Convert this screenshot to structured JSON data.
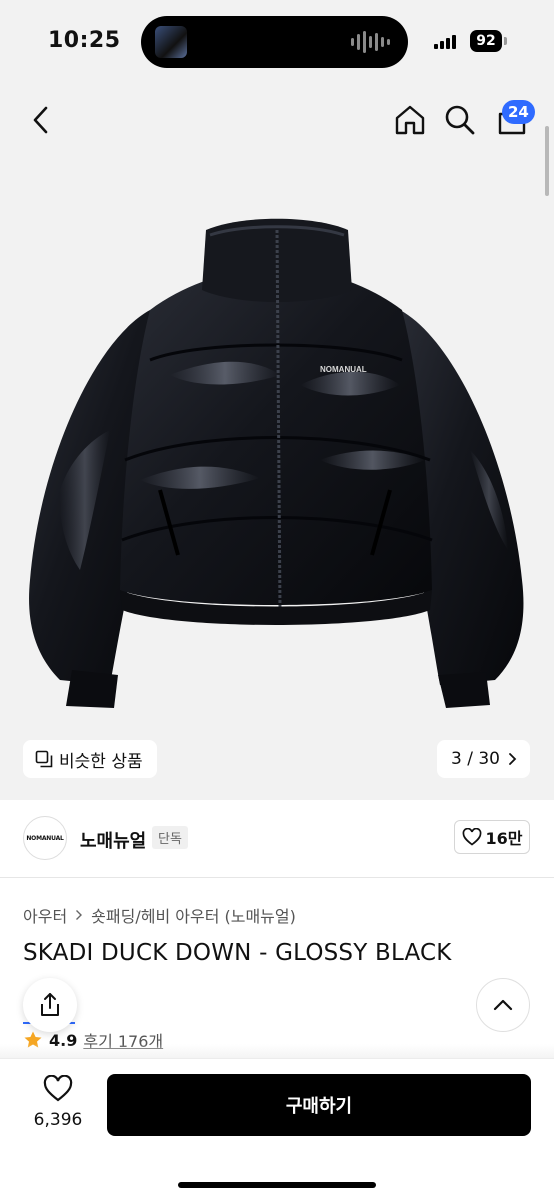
{
  "status": {
    "time": "10:25",
    "battery": "92"
  },
  "nav": {
    "cart_count": "24"
  },
  "image": {
    "similar_label": "비슷한 상품",
    "counter": "3 / 30",
    "jacket_logo": "NOMANUAL"
  },
  "brand": {
    "logo_text": "NOMANUAL",
    "name": "노매뉴얼",
    "tag": "단독",
    "likes": "16만"
  },
  "product": {
    "breadcrumb": [
      "아우터",
      "숏패딩/헤비 아우터 (노매뉴얼)"
    ],
    "title": "SKADI DUCK DOWN - GLOSSY BLACK",
    "rating": "4.9",
    "reviews": "후기 176개"
  },
  "bottom": {
    "wish_count": "6,396",
    "buy_label": "구매하기"
  },
  "colors": {
    "accent": "#2f6bff",
    "button": "#000000",
    "star": "#f5a623"
  }
}
